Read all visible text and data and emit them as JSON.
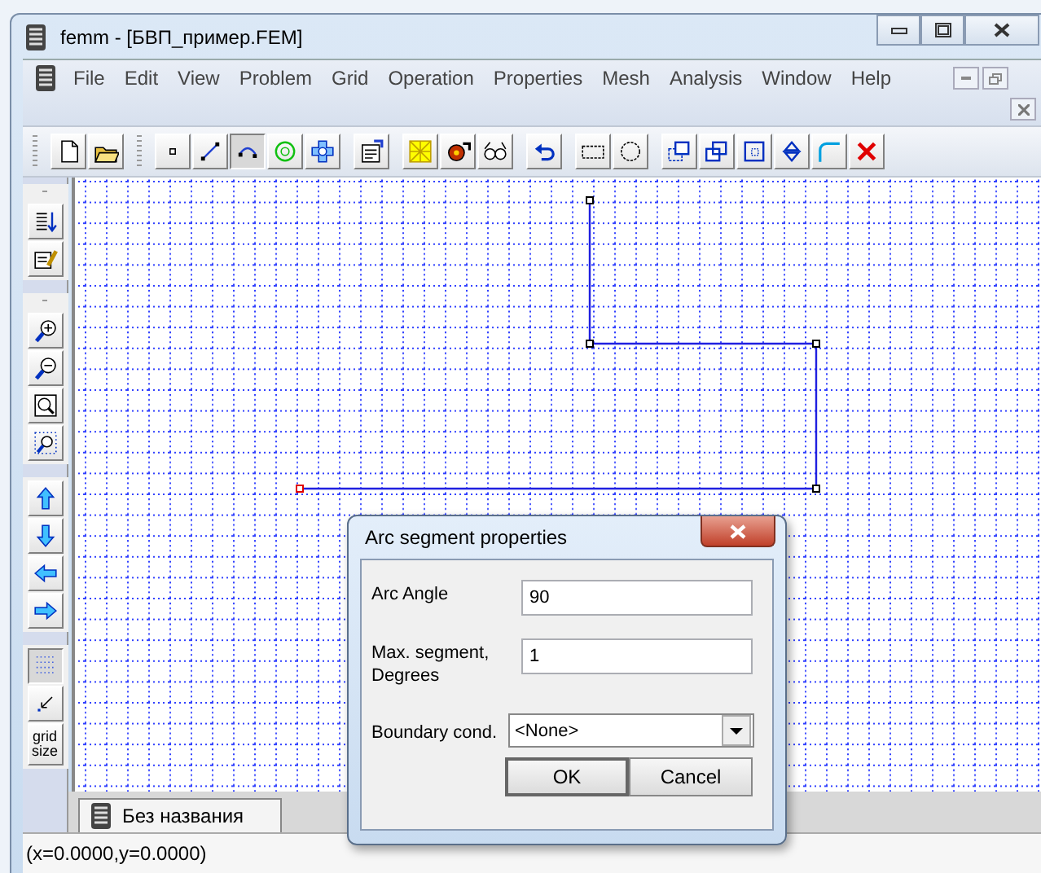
{
  "window": {
    "title": "femm - [БВП_пример.FEM]"
  },
  "menu": [
    "File",
    "Edit",
    "View",
    "Problem",
    "Grid",
    "Operation",
    "Properties",
    "Mesh",
    "Analysis",
    "Window",
    "Help"
  ],
  "toolbar": {
    "groups": [
      [
        {
          "kind": "new",
          "selected": false
        },
        {
          "kind": "open",
          "selected": false
        }
      ],
      [
        {
          "kind": "node",
          "selected": false
        },
        {
          "kind": "segment",
          "selected": false
        },
        {
          "kind": "arc",
          "selected": true
        },
        {
          "kind": "ring",
          "selected": false
        },
        {
          "kind": "block",
          "selected": false
        }
      ],
      [
        {
          "kind": "props",
          "selected": false
        }
      ],
      [
        {
          "kind": "mesh",
          "selected": false
        },
        {
          "kind": "run",
          "selected": false
        },
        {
          "kind": "view",
          "selected": false
        }
      ],
      [
        {
          "kind": "undo",
          "selected": false
        }
      ],
      [
        {
          "kind": "rect",
          "selected": false
        },
        {
          "kind": "circle",
          "selected": false
        }
      ],
      [
        {
          "kind": "move",
          "selected": false
        },
        {
          "kind": "copy",
          "selected": false
        },
        {
          "kind": "scale",
          "selected": false
        },
        {
          "kind": "mirror",
          "selected": false
        },
        {
          "kind": "fillet",
          "selected": false
        },
        {
          "kind": "delete",
          "selected": false
        }
      ]
    ]
  },
  "side_toolbar": {
    "groups": [
      [
        {
          "kind": "list",
          "selected": false
        },
        {
          "kind": "edit",
          "selected": false
        }
      ],
      [
        {
          "kind": "zoomin",
          "selected": false
        },
        {
          "kind": "zoomout",
          "selected": false
        },
        {
          "kind": "zoomfit",
          "selected": false
        },
        {
          "kind": "zoomwin",
          "selected": false
        }
      ],
      [
        {
          "kind": "up",
          "selected": false
        },
        {
          "kind": "down",
          "selected": false
        },
        {
          "kind": "left",
          "selected": false
        },
        {
          "kind": "right",
          "selected": false
        }
      ],
      [
        {
          "kind": "grid",
          "selected": true
        },
        {
          "kind": "snap",
          "selected": false
        },
        {
          "kind": "text",
          "label": "grid size",
          "selected": false
        }
      ]
    ]
  },
  "document_tab": {
    "label": "Без названия"
  },
  "status_bar": "(x=0.0000,y=0.0000)",
  "dialog": {
    "title": "Arc segment properties",
    "fields": [
      {
        "label": "Arc Angle",
        "value": "90"
      },
      {
        "label": "Max. segment, Degrees",
        "value": "1"
      }
    ],
    "dropdown": {
      "label": "Boundary cond.",
      "value": "<None>"
    },
    "buttons": [
      "OK",
      "Cancel"
    ]
  }
}
